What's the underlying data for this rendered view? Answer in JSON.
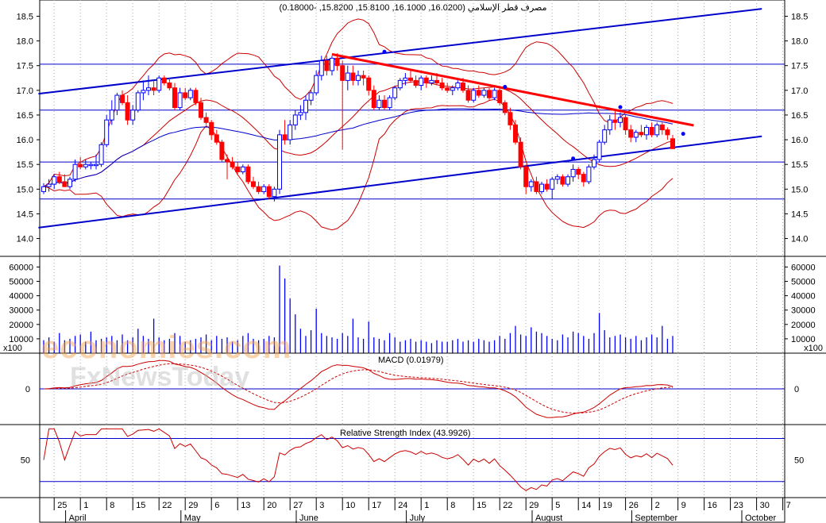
{
  "header": {
    "instrument": "مصرف قطر الإسلامي",
    "ohlc_text": "(16.0200, 16.1000, 15.8100, 15.8200, -0.18000)"
  },
  "watermark": {
    "line1": "economies.com",
    "line2": "FxNewsToday"
  },
  "colors": {
    "up": "#0000ff",
    "down": "#ff0000",
    "trend": "#0000cc",
    "bands": "#cc0000",
    "red_trend": "#ff0000",
    "grid": "#aaaaaa"
  },
  "chart_data": [
    {
      "type": "candlestick",
      "title": "مصرف قطر الإسلامي (16.0200, 16.1000, 15.8100, 15.8200, -0.18000)",
      "y_ticks": [
        "14.0",
        "14.5",
        "15.0",
        "15.5",
        "16.0",
        "16.5",
        "17.0",
        "17.5",
        "18.0",
        "18.5"
      ],
      "ylim": [
        13.8,
        18.7
      ],
      "x_range": [
        0,
        130
      ],
      "x_tick_labels": [
        {
          "i": 2,
          "label": "25"
        },
        {
          "i": 7,
          "label": "1"
        },
        {
          "i": 12,
          "label": "8"
        },
        {
          "i": 17,
          "label": "15"
        },
        {
          "i": 22,
          "label": "22"
        },
        {
          "i": 27,
          "label": "29"
        },
        {
          "i": 32,
          "label": "6"
        },
        {
          "i": 37,
          "label": "13"
        },
        {
          "i": 42,
          "label": "20"
        },
        {
          "i": 47,
          "label": "27"
        },
        {
          "i": 52,
          "label": "3"
        },
        {
          "i": 57,
          "label": "10"
        },
        {
          "i": 62,
          "label": "17"
        },
        {
          "i": 67,
          "label": "24"
        },
        {
          "i": 72,
          "label": "1"
        },
        {
          "i": 77,
          "label": "8"
        },
        {
          "i": 82,
          "label": "15"
        },
        {
          "i": 87,
          "label": "22"
        },
        {
          "i": 92,
          "label": "29"
        },
        {
          "i": 97,
          "label": "5"
        },
        {
          "i": 102,
          "label": "14"
        },
        {
          "i": 106,
          "label": "19"
        },
        {
          "i": 111,
          "label": "26"
        },
        {
          "i": 116,
          "label": "2"
        },
        {
          "i": 121,
          "label": "9"
        },
        {
          "i": 126,
          "label": "16"
        },
        {
          "i": 131,
          "label": "23"
        },
        {
          "i": 136,
          "label": "30"
        },
        {
          "i": 141,
          "label": "7"
        }
      ],
      "month_labels": [
        {
          "i": 6,
          "label": "April"
        },
        {
          "i": 28,
          "label": "May"
        },
        {
          "i": 50,
          "label": "June"
        },
        {
          "i": 71,
          "label": "July"
        },
        {
          "i": 95,
          "label": "August"
        },
        {
          "i": 114,
          "label": "September"
        },
        {
          "i": 135,
          "label": "October"
        }
      ],
      "horizontal_levels": [
        17.53,
        16.6,
        15.55,
        14.8
      ],
      "trendlines": [
        {
          "name": "upper-channel",
          "x1": -1,
          "y1": 16.93,
          "x2": 137,
          "y2": 18.65
        },
        {
          "name": "lower-channel",
          "x1": -1,
          "y1": 14.22,
          "x2": 137,
          "y2": 16.07
        },
        {
          "name": "red-resistance",
          "x1": 55,
          "y1": 17.73,
          "x2": 124,
          "y2": 16.29
        }
      ],
      "marker_points": [
        {
          "i": 65,
          "y": 17.78
        },
        {
          "i": 88,
          "y": 17.07
        },
        {
          "i": 101,
          "y": 15.62
        },
        {
          "i": 110,
          "y": 16.66
        },
        {
          "i": 122,
          "y": 16.12
        }
      ],
      "candles": [
        [
          14.95,
          15.12,
          14.9,
          15.05
        ],
        [
          15.05,
          15.2,
          14.95,
          15.1
        ],
        [
          15.1,
          15.3,
          15.0,
          15.25
        ],
        [
          15.25,
          15.35,
          15.1,
          15.15
        ],
        [
          15.15,
          15.3,
          15.05,
          15.05
        ],
        [
          15.05,
          15.25,
          15.0,
          15.2
        ],
        [
          15.2,
          15.6,
          15.15,
          15.5
        ],
        [
          15.5,
          15.65,
          15.4,
          15.45
        ],
        [
          15.45,
          15.6,
          15.4,
          15.5
        ],
        [
          15.5,
          15.55,
          15.4,
          15.5
        ],
        [
          15.5,
          15.7,
          15.4,
          15.5
        ],
        [
          15.5,
          15.95,
          15.45,
          15.9
        ],
        [
          15.9,
          16.5,
          15.85,
          16.4
        ],
        [
          16.4,
          16.8,
          16.3,
          16.6
        ],
        [
          16.6,
          16.95,
          16.5,
          16.9
        ],
        [
          16.9,
          17.0,
          16.7,
          16.75
        ],
        [
          16.75,
          16.9,
          16.3,
          16.4
        ],
        [
          16.4,
          16.7,
          16.3,
          16.6
        ],
        [
          16.6,
          17.0,
          16.55,
          16.95
        ],
        [
          16.95,
          17.2,
          16.8,
          17.0
        ],
        [
          17.0,
          17.3,
          16.9,
          17.05
        ],
        [
          17.05,
          17.2,
          16.9,
          17.0
        ],
        [
          17.0,
          17.3,
          16.95,
          17.25
        ],
        [
          17.25,
          17.3,
          17.1,
          17.15
        ],
        [
          17.15,
          17.25,
          17.0,
          17.05
        ],
        [
          17.05,
          17.15,
          16.6,
          16.65
        ],
        [
          16.65,
          17.05,
          16.6,
          16.95
        ],
        [
          16.95,
          17.05,
          16.8,
          16.85
        ],
        [
          16.85,
          17.05,
          16.8,
          17.0
        ],
        [
          17.0,
          17.05,
          16.7,
          16.75
        ],
        [
          16.75,
          16.85,
          16.4,
          16.45
        ],
        [
          16.45,
          16.55,
          16.3,
          16.35
        ],
        [
          16.35,
          16.4,
          16.0,
          16.1
        ],
        [
          16.1,
          16.2,
          15.9,
          15.95
        ],
        [
          15.95,
          16.0,
          15.55,
          15.6
        ],
        [
          15.6,
          15.7,
          15.2,
          15.55
        ],
        [
          15.55,
          15.65,
          15.4,
          15.45
        ],
        [
          15.45,
          15.55,
          15.3,
          15.35
        ],
        [
          15.35,
          15.5,
          15.3,
          15.45
        ],
        [
          15.45,
          15.5,
          15.1,
          15.15
        ],
        [
          15.15,
          15.25,
          15.0,
          15.05
        ],
        [
          15.05,
          15.15,
          14.9,
          14.95
        ],
        [
          14.95,
          15.1,
          14.9,
          15.05
        ],
        [
          15.05,
          15.1,
          14.8,
          14.85
        ],
        [
          14.85,
          15.05,
          14.75,
          15.0
        ],
        [
          15.0,
          16.2,
          14.9,
          16.1
        ],
        [
          16.1,
          16.4,
          15.9,
          16.0
        ],
        [
          16.0,
          16.4,
          15.9,
          16.3
        ],
        [
          16.3,
          16.6,
          16.2,
          16.5
        ],
        [
          16.5,
          16.7,
          16.4,
          16.55
        ],
        [
          16.55,
          16.9,
          16.4,
          16.8
        ],
        [
          16.8,
          17.0,
          16.7,
          16.95
        ],
        [
          16.95,
          17.4,
          16.9,
          17.3
        ],
        [
          17.3,
          17.7,
          17.2,
          17.6
        ],
        [
          17.6,
          17.7,
          17.3,
          17.4
        ],
        [
          17.4,
          17.7,
          17.3,
          17.65
        ],
        [
          17.65,
          17.75,
          17.4,
          17.5
        ],
        [
          17.5,
          17.6,
          15.8,
          17.2
        ],
        [
          17.2,
          17.5,
          17.0,
          17.35
        ],
        [
          17.35,
          17.5,
          17.1,
          17.2
        ],
        [
          17.2,
          17.4,
          17.1,
          17.3
        ],
        [
          17.3,
          17.4,
          17.1,
          17.25
        ],
        [
          17.25,
          17.3,
          16.9,
          17.0
        ],
        [
          17.0,
          17.1,
          16.6,
          16.65
        ],
        [
          16.65,
          16.9,
          16.6,
          16.8
        ],
        [
          16.8,
          16.9,
          16.6,
          16.65
        ],
        [
          16.65,
          16.9,
          16.6,
          16.85
        ],
        [
          16.85,
          17.1,
          16.8,
          17.05
        ],
        [
          17.05,
          17.25,
          17.0,
          17.2
        ],
        [
          17.2,
          17.35,
          17.1,
          17.25
        ],
        [
          17.25,
          17.4,
          17.15,
          17.2
        ],
        [
          17.2,
          17.3,
          17.05,
          17.1
        ],
        [
          17.1,
          17.3,
          17.0,
          17.25
        ],
        [
          17.25,
          17.3,
          17.05,
          17.15
        ],
        [
          17.15,
          17.3,
          17.1,
          17.2
        ],
        [
          17.2,
          17.35,
          17.1,
          17.15
        ],
        [
          17.15,
          17.25,
          17.0,
          17.05
        ],
        [
          17.05,
          17.15,
          16.95,
          17.0
        ],
        [
          17.0,
          17.1,
          16.9,
          17.05
        ],
        [
          17.05,
          17.2,
          17.0,
          17.15
        ],
        [
          17.15,
          17.25,
          16.95,
          17.0
        ],
        [
          17.0,
          17.1,
          16.75,
          16.8
        ],
        [
          16.8,
          17.05,
          16.75,
          17.0
        ],
        [
          17.0,
          17.1,
          16.85,
          16.9
        ],
        [
          16.9,
          17.05,
          16.85,
          17.0
        ],
        [
          17.0,
          17.05,
          16.8,
          16.85
        ],
        [
          16.85,
          17.05,
          16.8,
          17.0
        ],
        [
          17.0,
          17.05,
          16.7,
          16.75
        ],
        [
          16.75,
          16.8,
          16.5,
          16.55
        ],
        [
          16.55,
          16.65,
          16.2,
          16.3
        ],
        [
          16.3,
          16.4,
          15.9,
          15.95
        ],
        [
          15.95,
          16.05,
          15.4,
          15.45
        ],
        [
          15.45,
          15.5,
          14.9,
          15.05
        ],
        [
          15.05,
          15.2,
          14.95,
          15.15
        ],
        [
          15.15,
          15.25,
          14.9,
          14.95
        ],
        [
          14.95,
          15.15,
          14.9,
          15.1
        ],
        [
          15.1,
          15.2,
          14.95,
          15.0
        ],
        [
          15.0,
          15.25,
          14.8,
          15.2
        ],
        [
          15.2,
          15.3,
          15.1,
          15.25
        ],
        [
          15.25,
          15.3,
          15.05,
          15.1
        ],
        [
          15.1,
          15.3,
          15.05,
          15.25
        ],
        [
          15.25,
          15.5,
          15.15,
          15.4
        ],
        [
          15.4,
          15.45,
          15.2,
          15.3
        ],
        [
          15.3,
          15.35,
          15.05,
          15.15
        ],
        [
          15.15,
          15.5,
          15.1,
          15.45
        ],
        [
          15.45,
          15.7,
          15.4,
          15.6
        ],
        [
          15.6,
          16.0,
          15.55,
          15.95
        ],
        [
          15.95,
          16.3,
          15.9,
          16.2
        ],
        [
          16.2,
          16.5,
          16.1,
          16.4
        ],
        [
          16.4,
          16.6,
          16.2,
          16.35
        ],
        [
          16.35,
          16.55,
          16.25,
          16.45
        ],
        [
          16.45,
          16.5,
          16.1,
          16.2
        ],
        [
          16.2,
          16.3,
          15.95,
          16.05
        ],
        [
          16.05,
          16.2,
          15.95,
          16.15
        ],
        [
          16.15,
          16.3,
          16.05,
          16.1
        ],
        [
          16.1,
          16.3,
          16.0,
          16.25
        ],
        [
          16.25,
          16.35,
          16.05,
          16.1
        ],
        [
          16.1,
          16.35,
          16.05,
          16.3
        ],
        [
          16.3,
          16.35,
          16.1,
          16.2
        ],
        [
          16.2,
          16.25,
          16.0,
          16.1
        ],
        [
          16.02,
          16.1,
          15.81,
          15.82
        ]
      ]
    },
    {
      "type": "bar",
      "ylabel": "x100",
      "y_ticks": [
        "10000",
        "20000",
        "30000",
        "40000",
        "50000",
        "60000"
      ],
      "ylim": [
        5000,
        63000
      ],
      "values": [
        9000,
        11000,
        8000,
        14000,
        9000,
        10000,
        12000,
        13000,
        8000,
        15000,
        9000,
        10000,
        11000,
        12000,
        9000,
        13000,
        9000,
        11000,
        17000,
        12000,
        10000,
        24000,
        11000,
        9000,
        10000,
        14000,
        12000,
        8000,
        9000,
        10000,
        11000,
        13000,
        9000,
        12000,
        10000,
        11000,
        8000,
        9000,
        12000,
        14000,
        10000,
        9000,
        10000,
        12000,
        11000,
        61000,
        52000,
        38000,
        27000,
        17000,
        12000,
        16000,
        31000,
        14000,
        12000,
        11000,
        10000,
        14000,
        12000,
        24000,
        11000,
        10000,
        22000,
        11000,
        10000,
        9000,
        14000,
        11000,
        8000,
        9000,
        10000,
        8000,
        9000,
        8000,
        7000,
        9000,
        8000,
        8000,
        9000,
        10000,
        8000,
        9000,
        8000,
        10000,
        9000,
        8000,
        9000,
        12000,
        10000,
        14000,
        19000,
        13000,
        12000,
        18000,
        15000,
        14000,
        12000,
        10000,
        9000,
        13000,
        11000,
        15000,
        14000,
        12000,
        10000,
        14000,
        28000,
        16000,
        11000,
        12000,
        13000,
        11000,
        10000,
        12000,
        9000,
        11000,
        13000,
        11000,
        19000,
        10000,
        12000
      ]
    },
    {
      "type": "line",
      "title": "MACD (0.01979)",
      "y_ticks": [
        "0"
      ],
      "ylim": [
        -0.55,
        0.55
      ]
    },
    {
      "type": "line",
      "title": "Relative Strength Index (43.9926)",
      "y_ticks": [
        "50"
      ],
      "ylim": [
        18,
        80
      ],
      "levels": [
        70,
        30
      ]
    }
  ]
}
